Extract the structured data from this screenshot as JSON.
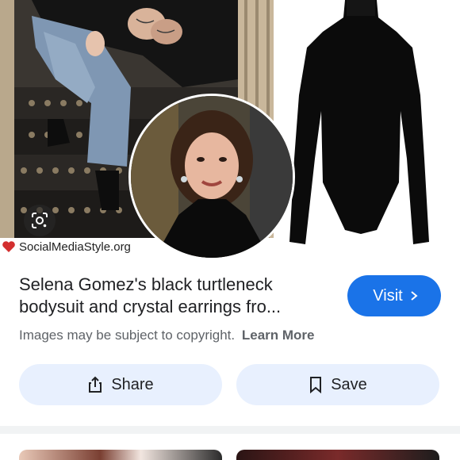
{
  "hero": {
    "watermark_text": "SocialMediaStyle.org",
    "lens_icon": "lens-search-icon"
  },
  "result": {
    "title": "Selena Gomez's black turtleneck bodysuit and crystal earrings fro...",
    "visit_label": "Visit",
    "copyright_text": "Images may be subject to copyright.",
    "learn_more_label": "Learn More"
  },
  "actions": {
    "share_label": "Share",
    "save_label": "Save"
  },
  "colors": {
    "accent": "#1a73e8",
    "button_bg": "#e8f0fe",
    "muted_text": "#5f6368"
  }
}
